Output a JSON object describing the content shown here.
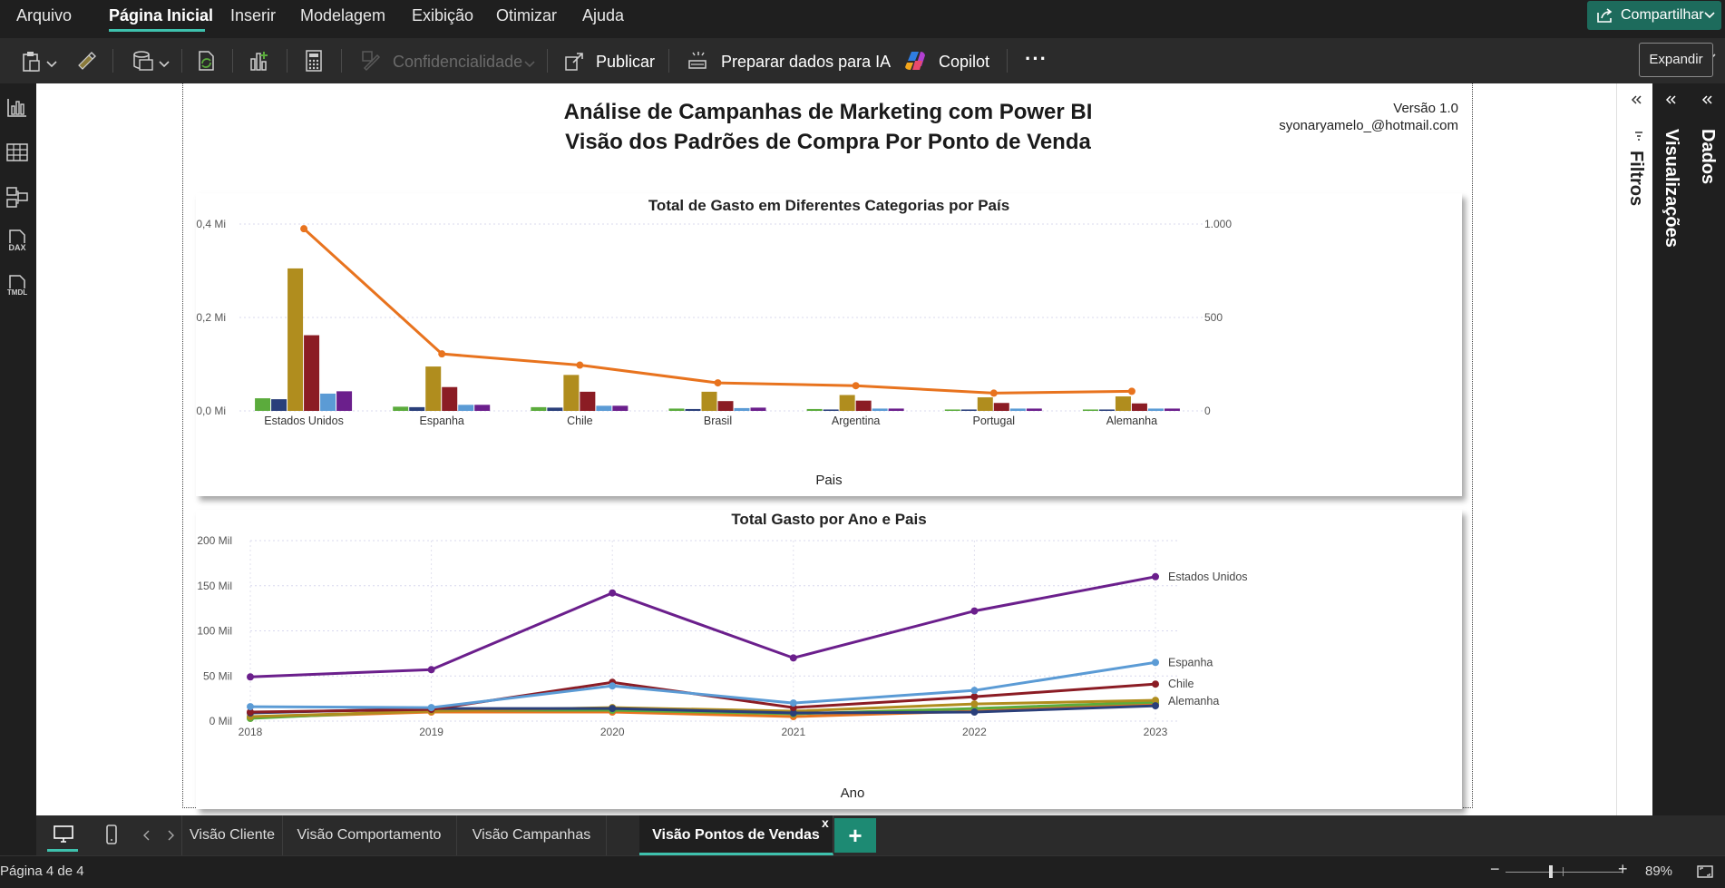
{
  "menu": {
    "items": [
      "Arquivo",
      "Página Inicial",
      "Inserir",
      "Modelagem",
      "Exibição",
      "Otimizar",
      "Ajuda"
    ],
    "share": "Compartilhar"
  },
  "toolbar": {
    "confidencialidade": "Confidencialidade",
    "publicar": "Publicar",
    "preparar": "Preparar dados para IA",
    "copilot": "Copilot",
    "more": "···",
    "tooltip": "Expandir"
  },
  "leftrail": {
    "dax": "DAX",
    "tmdl": "TMDL"
  },
  "report": {
    "title_line1": "Análise de Campanhas de Marketing com Power BI",
    "title_line2": "Visão dos Padrões de Compra Por Ponto de Venda",
    "version": "Versão 1.0",
    "email": "syonaryamelo_@hotmail.com"
  },
  "panes": {
    "filtros": "Filtros",
    "visualizacoes": "Visualizações",
    "dados": "Dados"
  },
  "tabs": {
    "items": [
      "Visão Cliente",
      "Visão Comportamento",
      "Visão Campanhas",
      "Visão Pontos de Vendas"
    ],
    "close": "x",
    "add": "+"
  },
  "status": {
    "page": "Página 4 de 4",
    "zoom": "89%"
  },
  "colors": {
    "accent": "#3ec1ad",
    "share_bg": "#1d6b5c",
    "series": [
      "#5bab3c",
      "#2a3f7a",
      "#b08d1e",
      "#8b1c24",
      "#5b9bd5",
      "#6b1f8c"
    ],
    "line": "#e8731e"
  },
  "chart_data": [
    {
      "type": "bar",
      "title": "Total de Gasto em Diferentes Categorias por País",
      "xlabel": "Pais",
      "categories": [
        "Estados Unidos",
        "Espanha",
        "Chile",
        "Brasil",
        "Argentina",
        "Portugal",
        "Alemanha"
      ],
      "y_ticks_left": [
        "0,0 Mi",
        "0,2 Mi",
        "0,4 Mi"
      ],
      "y_ticks_right": [
        "0",
        "500",
        "1.000"
      ],
      "ylim": [
        0,
        0.4
      ],
      "y2lim": [
        0,
        1000
      ],
      "series": [
        {
          "values": [
            0.027,
            0.009,
            0.008,
            0.005,
            0.004,
            0.003,
            0.003
          ]
        },
        {
          "values": [
            0.025,
            0.008,
            0.007,
            0.004,
            0.003,
            0.003,
            0.003
          ]
        },
        {
          "values": [
            0.305,
            0.095,
            0.077,
            0.041,
            0.034,
            0.029,
            0.031
          ]
        },
        {
          "values": [
            0.162,
            0.051,
            0.041,
            0.021,
            0.022,
            0.017,
            0.016
          ]
        },
        {
          "values": [
            0.037,
            0.013,
            0.011,
            0.006,
            0.005,
            0.005,
            0.005
          ]
        },
        {
          "values": [
            0.042,
            0.013,
            0.011,
            0.007,
            0.005,
            0.005,
            0.005
          ]
        }
      ],
      "line": {
        "values": [
          975,
          305,
          245,
          150,
          135,
          95,
          105
        ]
      },
      "grid": true
    },
    {
      "type": "line",
      "title": "Total Gasto por Ano e Pais",
      "xlabel": "Ano",
      "x": [
        "2018",
        "2019",
        "2020",
        "2021",
        "2022",
        "2023"
      ],
      "y_ticks": [
        "0 Mil",
        "50 Mil",
        "100 Mil",
        "150 Mil",
        "200 Mil"
      ],
      "ylim": [
        0,
        200
      ],
      "series": [
        {
          "name": "Estados Unidos",
          "values": [
            49,
            57,
            142,
            70,
            122,
            160
          ]
        },
        {
          "name": "Espanha",
          "values": [
            16,
            15,
            39,
            20,
            34,
            65
          ]
        },
        {
          "name": "Chile",
          "values": [
            10,
            13,
            43,
            15,
            27,
            41
          ]
        },
        {
          "name": "Alemanha",
          "values": [
            9,
            14,
            14,
            9,
            10,
            17
          ]
        },
        {
          "values": [
            5,
            11,
            15,
            11,
            19,
            23
          ]
        },
        {
          "values": [
            3,
            12,
            12,
            8,
            14,
            21
          ]
        },
        {
          "values": [
            4,
            10,
            10,
            5,
            11,
            19
          ]
        }
      ],
      "grid": true
    }
  ]
}
